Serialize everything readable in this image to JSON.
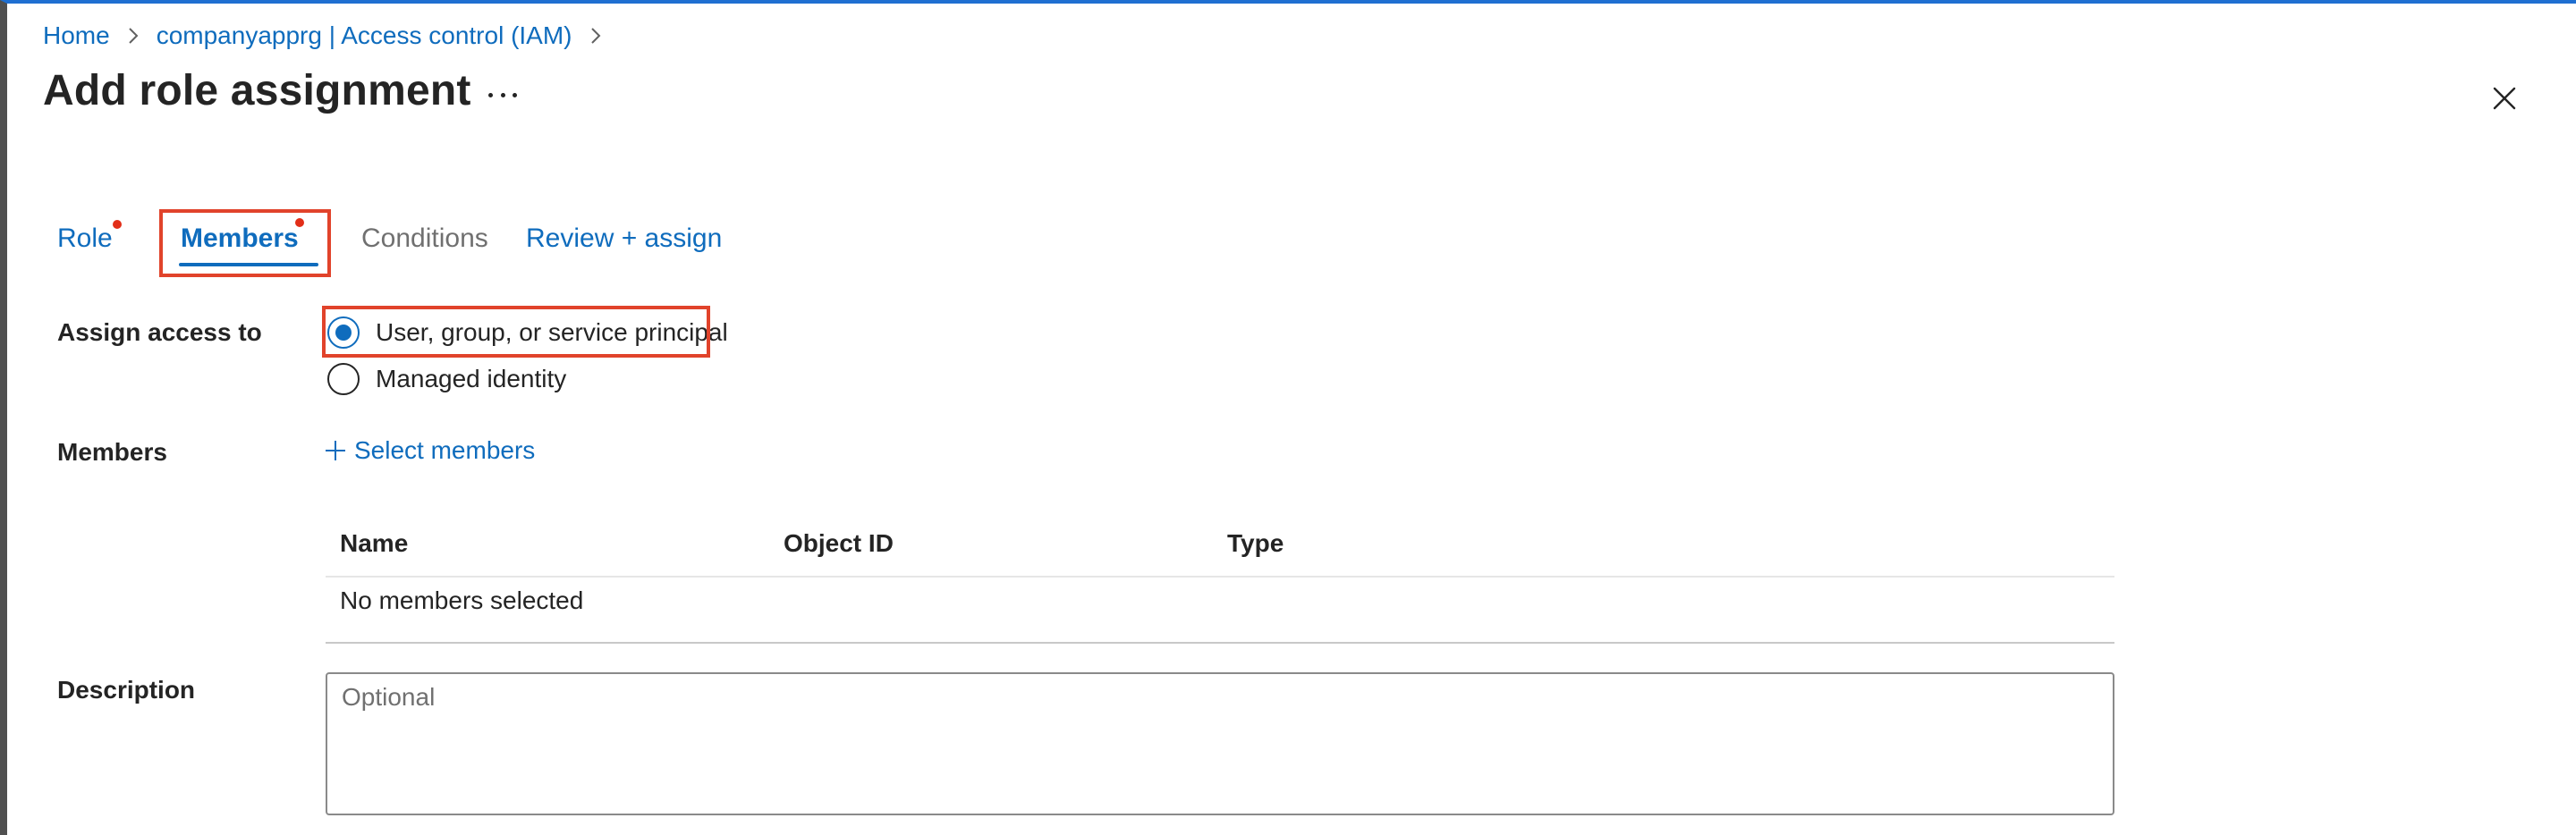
{
  "breadcrumb": {
    "items": [
      "Home",
      "companyapprg | Access control (IAM)"
    ]
  },
  "page": {
    "title": "Add role assignment",
    "more_icon": "ellipsis-icon",
    "close_icon": "close-icon"
  },
  "tabs": [
    {
      "label": "Role",
      "required": true,
      "state": "default"
    },
    {
      "label": "Members",
      "required": true,
      "state": "selected"
    },
    {
      "label": "Conditions",
      "required": false,
      "state": "disabled"
    },
    {
      "label": "Review + assign",
      "required": false,
      "state": "default"
    }
  ],
  "assign_access": {
    "label": "Assign access to",
    "options": [
      "User, group, or service principal",
      "Managed identity"
    ],
    "selected": "User, group, or service principal"
  },
  "members": {
    "label": "Members",
    "select_label": "Select members",
    "columns": [
      "Name",
      "Object ID",
      "Type"
    ],
    "empty_text": "No members selected"
  },
  "description": {
    "label": "Description",
    "placeholder": "Optional",
    "value": ""
  },
  "colors": {
    "accent": "#0f6cbd",
    "highlight": "#e1432b",
    "required_dot": "#e22e18",
    "top_border": "#1f6fd1"
  }
}
